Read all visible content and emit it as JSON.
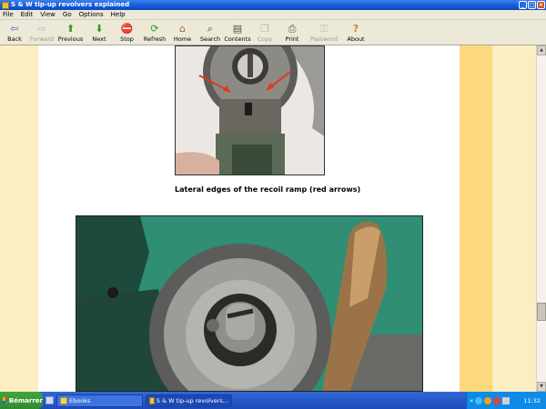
{
  "window": {
    "title": "S & W tip-up revolvers explained"
  },
  "menu": [
    "File",
    "Edit",
    "View",
    "Go",
    "Options",
    "Help"
  ],
  "toolbar": {
    "back": "Back",
    "forward": "Forward",
    "previous": "Previous",
    "next": "Next",
    "stop": "Stop",
    "refresh": "Refresh",
    "home": "Home",
    "search": "Search",
    "contents": "Contents",
    "copy": "Copy",
    "print": "Print",
    "password": "Password",
    "about": "About"
  },
  "content": {
    "caption": "Lateral edges of the recoil ramp (red arrows)"
  },
  "taskbar": {
    "start": "Bémarrer",
    "tasks": [
      "Ebooks",
      "S & W tip-up revolvers..."
    ],
    "clock": "11:32"
  },
  "colors": {
    "titlebar": "#0a48c4",
    "left_stripe": "#fbeec2",
    "right_stripe": "#fcd97c",
    "photo_bg": "#2e8b73"
  }
}
